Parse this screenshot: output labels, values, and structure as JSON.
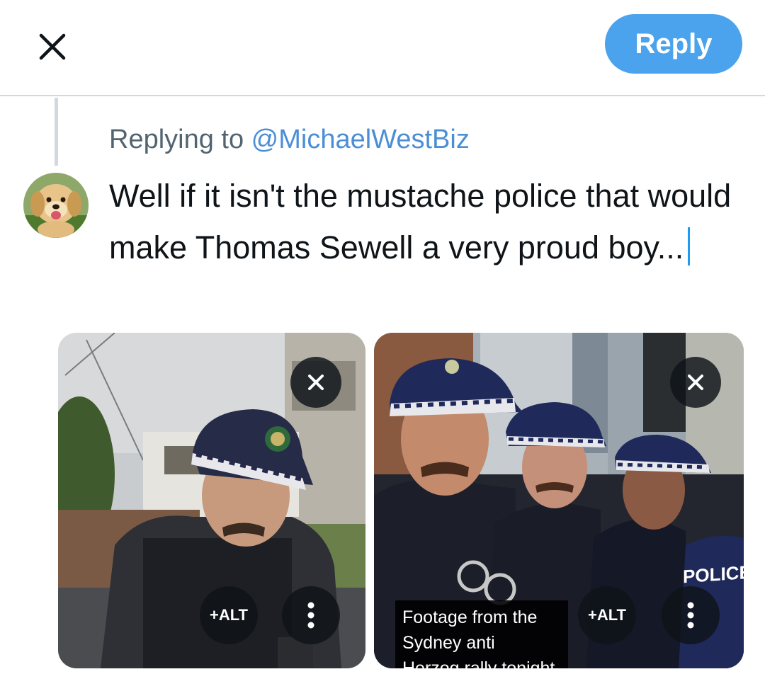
{
  "topbar": {
    "close_icon": "close-icon",
    "reply_label": "Reply",
    "accent_color": "#4aa3ec"
  },
  "reply_context": {
    "prefix": "Replying to ",
    "handle": "@MichaelWestBiz"
  },
  "compose": {
    "text": "Well if it isn't the mustache police that would make Thomas Sewell a very proud boy..."
  },
  "attachments": [
    {
      "alt_label": "+ALT",
      "remove_icon": "close-icon",
      "more_icon": "more-vertical-icon"
    },
    {
      "alt_label": "+ALT",
      "remove_icon": "close-icon",
      "more_icon": "more-vertical-icon",
      "caption_line1": "Footage from the Sydney anti",
      "caption_line2": "Herzog rally tonight",
      "vest_label": "POLICE"
    }
  ]
}
